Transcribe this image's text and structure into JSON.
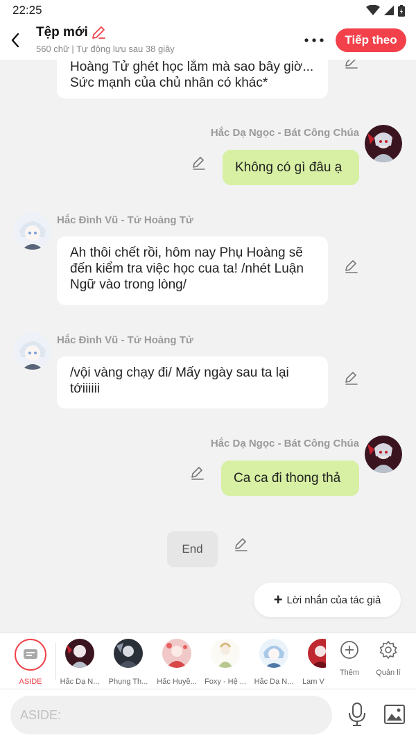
{
  "status": {
    "time": "22:25"
  },
  "header": {
    "title": "Tệp mới",
    "subtitle": "560 chữ | Tự động lưu sau 38 giây",
    "next_label": "Tiếp theo"
  },
  "messages": [
    {
      "side": "left",
      "speaker": "",
      "text": "Hoàng Tử ghét học lắm mà sao bây giờ... Sức mạnh của chủ nhân có khác*"
    },
    {
      "side": "right",
      "speaker": "Hắc Dạ Ngọc - Bát Công Chúa",
      "text": "Không có gì đâu ạ"
    },
    {
      "side": "left",
      "speaker": "Hắc Đình Vũ - Tứ Hoàng Tử",
      "text": "Ah thôi chết rồi, hôm nay Phụ Hoàng sẽ đến kiểm tra việc học cua ta! /nhét Luận Ngữ vào trong lòng/"
    },
    {
      "side": "left",
      "speaker": "Hắc Đình Vũ - Tứ Hoàng Tử",
      "text": "/vội vàng chạy đi/ Mấy ngày sau ta lại tớiiiiii"
    },
    {
      "side": "right",
      "speaker": "Hắc Dạ Ngọc - Bát Công Chúa",
      "text": "Ca ca đi thong thả"
    }
  ],
  "end_label": "End",
  "author_note_label": "Lời nhắn của tác giả",
  "characters": [
    {
      "label": "ASIDE",
      "icon": "chat-bubble-icon"
    },
    {
      "label": "Hắc Dạ N...",
      "icon": "avatar"
    },
    {
      "label": "Phụng Th...",
      "icon": "avatar"
    },
    {
      "label": "Hắc Huyề...",
      "icon": "avatar"
    },
    {
      "label": "Foxy - Hệ ...",
      "icon": "avatar"
    },
    {
      "label": "Hắc Dạ N...",
      "icon": "avatar"
    },
    {
      "label": "Lam V",
      "icon": "avatar"
    }
  ],
  "tools": {
    "add_label": "Thêm",
    "manage_label": "Quản lí"
  },
  "input": {
    "placeholder": "ASIDE:"
  },
  "colors": {
    "accent": "#f2414a",
    "right_bubble": "#d7f0a3",
    "left_bubble": "#ffffff",
    "background": "#f2f2f2"
  }
}
